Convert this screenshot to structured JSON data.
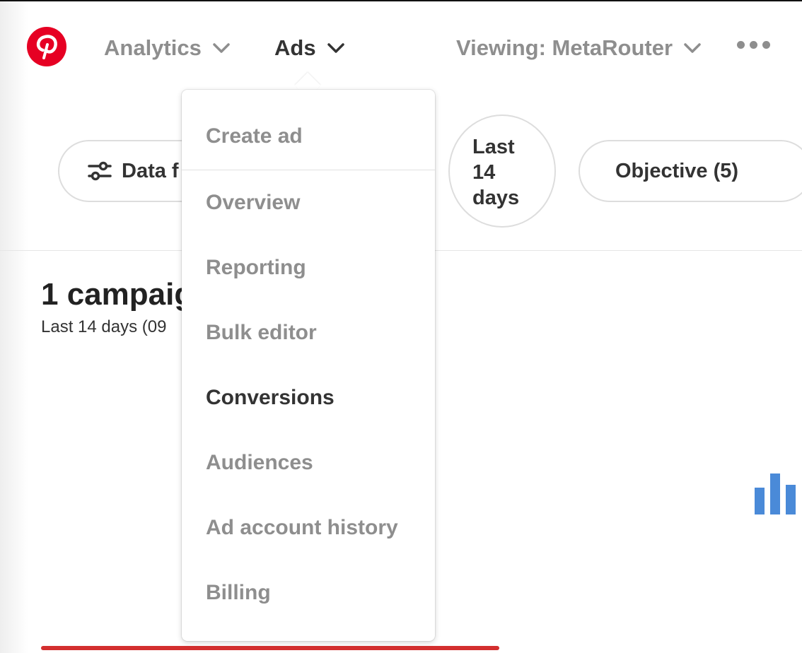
{
  "header": {
    "logo_icon": "pinterest-logo",
    "brand_color": "#e60023",
    "nav": {
      "analytics": "Analytics",
      "ads": "Ads",
      "viewing": "Viewing: MetaRouter"
    },
    "more_icon": "more-horizontal-icon"
  },
  "filters": {
    "data_filter_label": "Data f",
    "date_range_line1": "Last",
    "date_range_line2": "14",
    "date_range_line3": "days",
    "objective_label": "Objective (5)"
  },
  "summary": {
    "title": "1 campaig",
    "subtitle": "Last 14 days (09"
  },
  "ads_menu": {
    "items": [
      {
        "label": "Create ad",
        "active": false
      },
      {
        "label": "Overview",
        "active": false
      },
      {
        "label": "Reporting",
        "active": false
      },
      {
        "label": "Bulk editor",
        "active": false
      },
      {
        "label": "Conversions",
        "active": true
      },
      {
        "label": "Audiences",
        "active": false
      },
      {
        "label": "Ad account history",
        "active": false
      },
      {
        "label": "Billing",
        "active": false
      }
    ]
  },
  "colors": {
    "accent_red": "#d32f2f",
    "chart_icon_blue": "#4a8ad8",
    "muted_text": "#8e8e8e",
    "primary_text": "#333333"
  }
}
